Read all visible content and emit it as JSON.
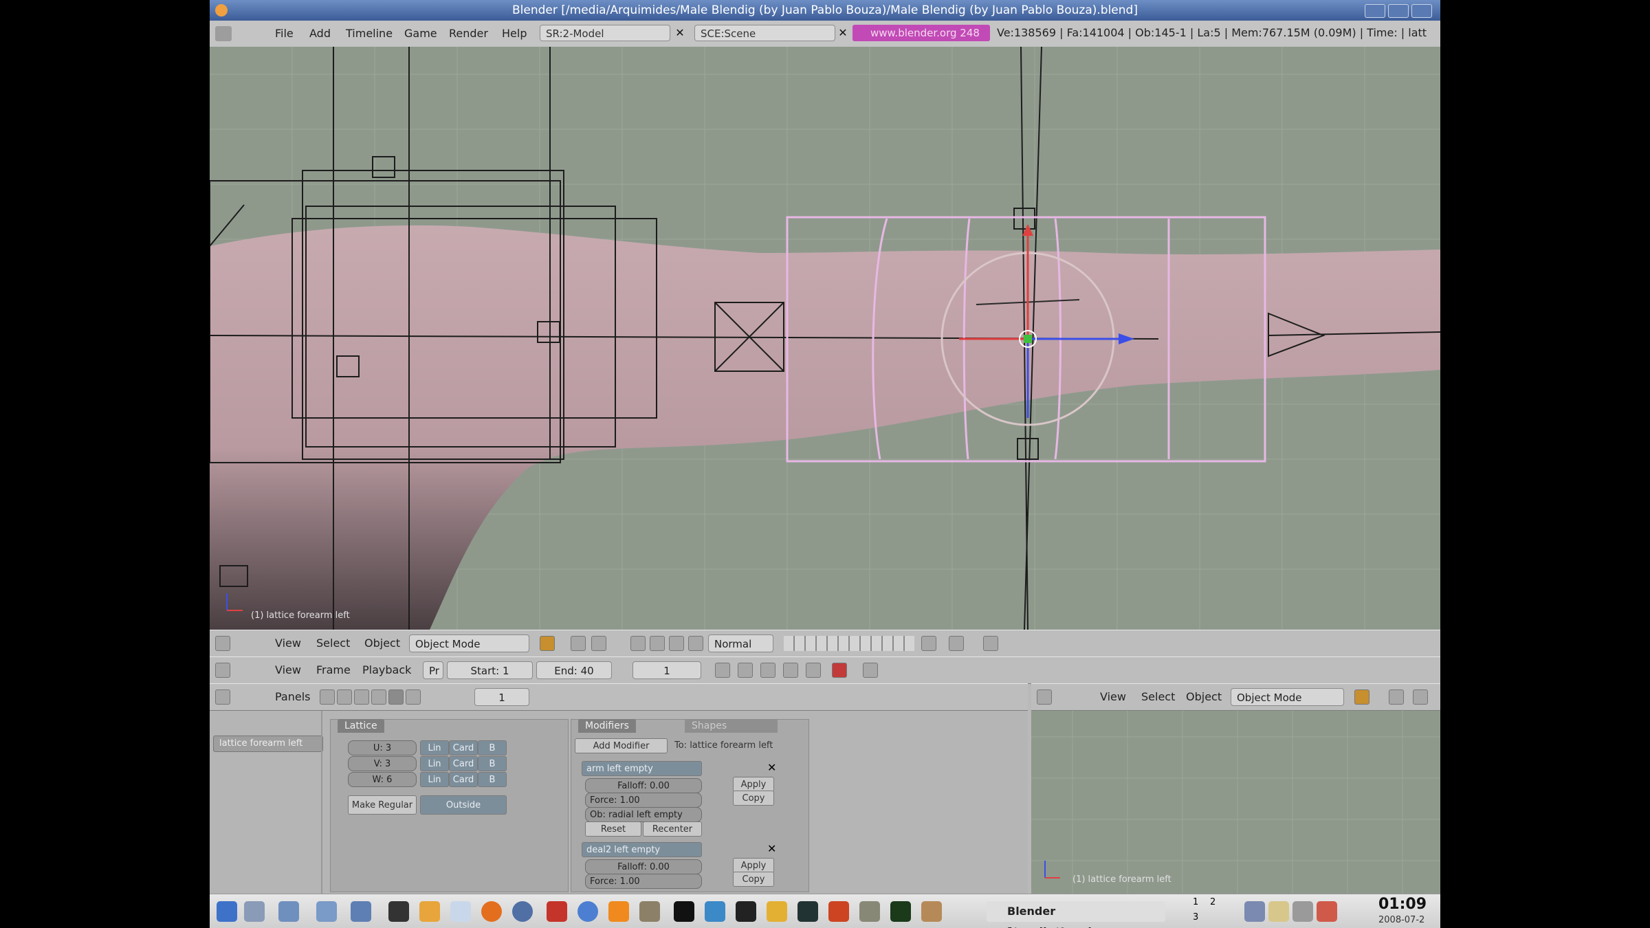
{
  "window": {
    "title": "Blender [/media/Arquimides/Male Blendig (by Juan Pablo Bouza)/Male Blendig (by Juan Pablo Bouza).blend]"
  },
  "menubar": {
    "items": [
      "File",
      "Add",
      "Timeline",
      "Game",
      "Render",
      "Help"
    ],
    "screen_field": "SR:2-Model",
    "scene_field": "SCE:Scene",
    "url": "www.blender.org 248",
    "stats": "Ve:138569 | Fa:141004 | Ob:145-1 | La:5 | Mem:767.15M (0.09M) | Time: | latt"
  },
  "viewport": {
    "label": "(1) lattice forearm left"
  },
  "view_header": {
    "menus": [
      "View",
      "Select",
      "Object"
    ],
    "mode": "Object Mode",
    "shading": "Normal"
  },
  "timeline_header": {
    "menus": [
      "View",
      "Frame",
      "Playback"
    ],
    "pr": "Pr",
    "start": "Start: 1",
    "end": "End: 40",
    "current": "1"
  },
  "buttons_header": {
    "panels_label": "Panels",
    "frame": "1"
  },
  "object_name": "lattice forearm left",
  "lattice_panel": {
    "tab": "Lattice",
    "rows": [
      {
        "label": "U: 3",
        "lin": "Lin",
        "card": "Card",
        "b": "B"
      },
      {
        "label": "V: 3",
        "lin": "Lin",
        "card": "Card",
        "b": "B"
      },
      {
        "label": "W: 6",
        "lin": "Lin",
        "card": "Card",
        "b": "B"
      }
    ],
    "make_regular": "Make Regular",
    "outside": "Outside"
  },
  "modifiers_panel": {
    "tab_modifiers": "Modifiers",
    "tab_shapes": "Shapes",
    "add_modifier": "Add Modifier",
    "to_object": "To: lattice forearm left",
    "mod1": {
      "name": "arm left empty",
      "falloff": "Falloff: 0.00",
      "force": "Force: 1.00",
      "ob": "Ob: radial left empty",
      "reset": "Reset",
      "recenter": "Recenter",
      "apply": "Apply",
      "copy": "Copy"
    },
    "mod2": {
      "name": "deal2 left empty",
      "falloff": "Falloff: 0.00",
      "force": "Force: 1.00",
      "apply": "Apply",
      "copy": "Copy"
    }
  },
  "small_view": {
    "menus": [
      "View",
      "Select",
      "Object"
    ],
    "mode": "Object Mode",
    "label": "(1) lattice forearm left"
  },
  "taskbar": {
    "app_label": "Blender [/media/Arquim...",
    "desktops": [
      "1",
      "2",
      "3"
    ],
    "clock": "01:09",
    "date": "2008-07-2"
  },
  "colors": {
    "viewport_bg": "#8e998c",
    "lattice_selected": "#e7b8e4",
    "url_field": "#c24ab6",
    "titlebar": "#4a6aa6"
  },
  "icons": [
    "blender-logo-icon",
    "close-icon",
    "minimize-icon",
    "maximize-icon",
    "play-icon",
    "rewind-icon",
    "record-icon",
    "firefox-icon",
    "terminal-icon",
    "clock-icon"
  ]
}
